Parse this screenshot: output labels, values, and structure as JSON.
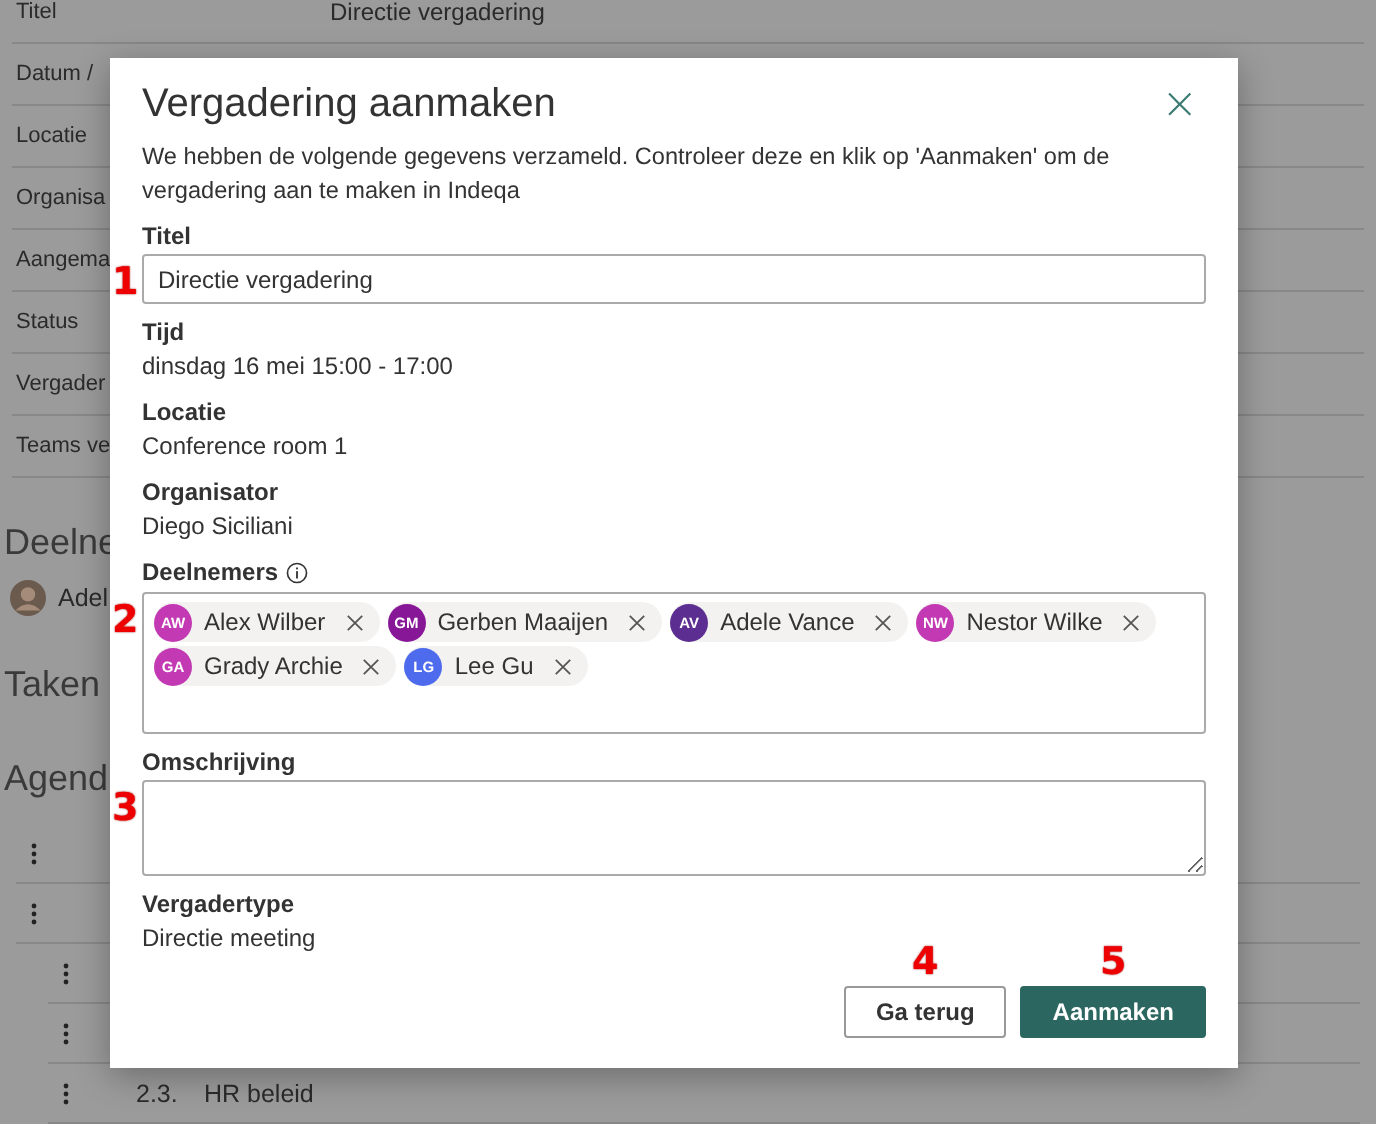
{
  "background": {
    "details": [
      {
        "label": "Titel",
        "value": "Directie vergadering"
      },
      {
        "label": "Datum /"
      },
      {
        "label": "Locatie"
      },
      {
        "label": "Organisa"
      },
      {
        "label": "Aangema"
      },
      {
        "label": "Status"
      },
      {
        "label": "Vergader"
      },
      {
        "label": "Teams ve"
      }
    ],
    "participants_heading": "Deelne",
    "participants": [
      {
        "name": "Adel"
      }
    ],
    "tasks_heading": "Taken",
    "agenda_heading": "Agend",
    "agenda": [
      {
        "kind": "row"
      },
      {
        "kind": "row",
        "children": [
          {
            "kind": "row"
          },
          {
            "kind": "row"
          },
          {
            "kind": "row",
            "number": "2.3.",
            "title": "HR beleid"
          }
        ]
      }
    ]
  },
  "dialog": {
    "title": "Vergadering aanmaken",
    "close": "×",
    "description": "We hebben de volgende gegevens verzameld. Controleer deze en klik op 'Aanmaken' om de vergadering aan te maken in Indeqa",
    "fields": [
      {
        "kind": "input",
        "label": "Titel",
        "value": "Directie vergadering",
        "marker": "1"
      },
      {
        "kind": "text",
        "label": "Tijd",
        "value": "dinsdag 16 mei 15:00 - 17:00"
      },
      {
        "kind": "text",
        "label": "Locatie",
        "value": "Conference room 1"
      },
      {
        "kind": "text",
        "label": "Organisator",
        "value": "Diego Siciliani"
      },
      {
        "kind": "people",
        "label": "Deelnemers",
        "info": true,
        "marker": "2",
        "people": [
          {
            "initials": "AW",
            "name": "Alex Wilber",
            "color": "#c239b3"
          },
          {
            "initials": "GM",
            "name": "Gerben Maaijen",
            "color": "#881798"
          },
          {
            "initials": "AV",
            "name": "Adele Vance",
            "color": "#5c2e91"
          },
          {
            "initials": "NW",
            "name": "Nestor Wilke",
            "color": "#c239b3"
          },
          {
            "initials": "GA",
            "name": "Grady Archie",
            "color": "#c239b3"
          },
          {
            "initials": "LG",
            "name": "Lee Gu",
            "color": "#4f6bed"
          }
        ]
      },
      {
        "kind": "textarea",
        "label": "Omschrijving",
        "marker": "3"
      },
      {
        "kind": "text",
        "label": "Vergadertype",
        "value": "Directie meeting"
      }
    ],
    "buttons": [
      {
        "label": "Ga terug",
        "primary": false,
        "marker": "4"
      },
      {
        "label": "Aanmaken",
        "primary": true,
        "marker": "5"
      }
    ]
  }
}
